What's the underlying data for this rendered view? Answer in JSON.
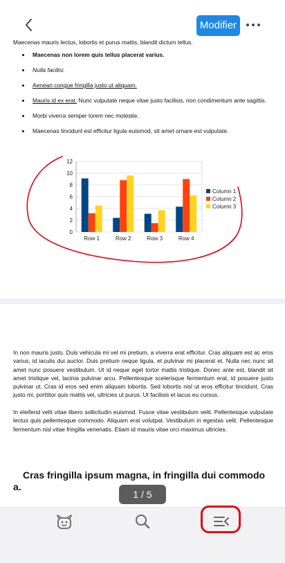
{
  "toolbar": {
    "modify_label": "Modifier",
    "back_icon": "chevron-left-icon",
    "more_icon": "more-horizontal-icon"
  },
  "document": {
    "top_paragraph": "Maecenas mauris lectus, lobortis et purus mattis, blandit dictum tellus.",
    "bullets": {
      "b1": "Maecenas non lorem quis tellus placerat varius.",
      "b2": "Nulla facilisi.",
      "b3": "Aenean congue fringilla justo ut aliquam.",
      "b4_link": "Mauris id ex erat.",
      "b4_rest": " Nunc vulputate neque vitae justo facilisis, non condimentum ante sagittis.",
      "b5": "Morbi viverra semper lorem nec molestie.",
      "b6": "Maecenas tincidunt est efficitur ligula euismod, sit amet ornare est vulputate."
    },
    "paragraph1": "In non mauris justo. Duis vehicula mi vel mi pretium, a viverra erat efficitur. Cras aliquam est ac eros varius, id iaculis dui auctor. Duis pretium neque ligula, et pulvinar mi placerat et. Nulla nec nunc sit amet nunc posuere vestibulum. Ut id neque eget tortor mattis tristique. Donec ante est, blandit sit amet tristique vel, lacinia pulvinar arcu. Pellentesque scelerisque fermentum erat, id posuere justo pulvinar ut. Cras id eros sed enim aliquam lobortis. Sed lobortis nisl ut eros efficitur tincidunt. Cras justo mi, porttitor quis mattis vel, ultricies ut purus. Ut facilisis et lacus eu cursus.",
    "paragraph2": "In eleifend velit vitae libero sollicitudin euismod. Fusce vitae vestibulum velit. Pellentesque vulputate lectus quis pellentesque commodo. Aliquam erat volutpat. Vestibulum in egestas velit. Pellentesque fermentum nisl vitae fringilla venenatis. Etiam id mauris vitae orci maximus ultricies.",
    "heading": "Cras fringilla ipsum magna, in fringilla dui commodo a."
  },
  "chart_data": {
    "type": "bar",
    "categories": [
      "Row 1",
      "Row 2",
      "Row 3",
      "Row 4"
    ],
    "series": [
      {
        "name": "Column 1",
        "values": [
          9.1,
          2.4,
          3.1,
          4.3
        ],
        "color": "#004586"
      },
      {
        "name": "Column 2",
        "values": [
          3.2,
          8.8,
          1.5,
          9.0
        ],
        "color": "#ff420e"
      },
      {
        "name": "Column 3",
        "values": [
          4.5,
          9.6,
          3.7,
          6.2
        ],
        "color": "#ffd320"
      }
    ],
    "yticks": [
      "0",
      "2",
      "4",
      "6",
      "8",
      "10",
      "12"
    ],
    "ylim": [
      0,
      12
    ],
    "grid": true,
    "legend": "right"
  },
  "pager": {
    "label": "1 / 5"
  },
  "bottombar": {
    "icons": [
      "robot-face-icon",
      "search-icon",
      "list-collapse-icon"
    ]
  },
  "annotation_color": "#e60012"
}
